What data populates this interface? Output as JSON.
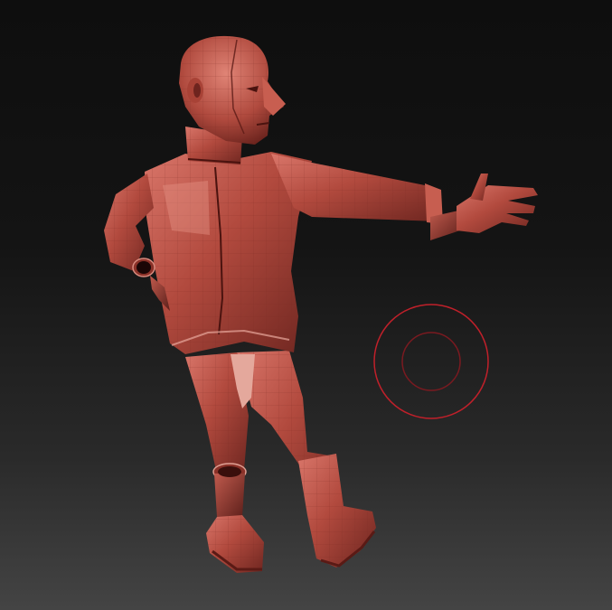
{
  "viewport": {
    "model": "sculpted-figure",
    "material_color": "#b5483c",
    "brush_cursor_color": "#c0202a"
  }
}
